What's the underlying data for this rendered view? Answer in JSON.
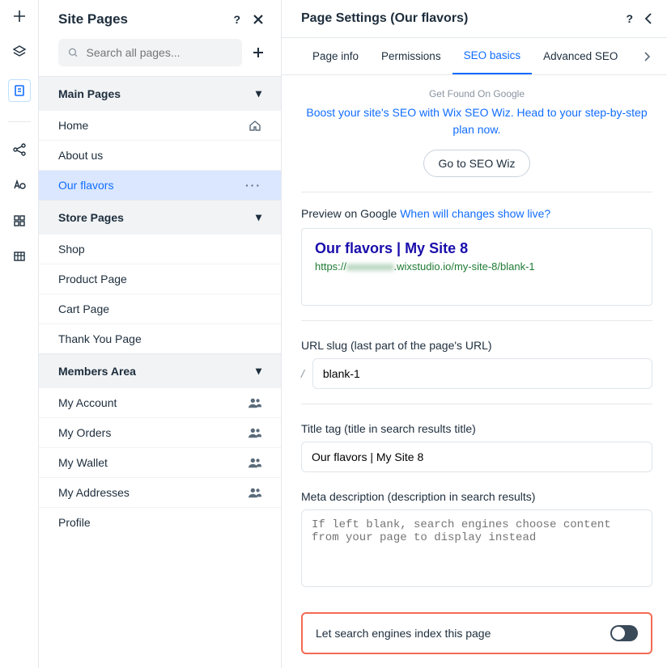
{
  "rail": {
    "icons": [
      "plus",
      "layers",
      "page",
      "share",
      "typography",
      "apps",
      "table"
    ]
  },
  "sidebar": {
    "title": "Site Pages",
    "search_placeholder": "Search all pages...",
    "sections": [
      {
        "label": "Main Pages",
        "items": [
          {
            "label": "Home",
            "icon": "home"
          },
          {
            "label": "About us"
          },
          {
            "label": "Our flavors",
            "selected": true,
            "more": true
          }
        ]
      },
      {
        "label": "Store Pages",
        "items": [
          {
            "label": "Shop"
          },
          {
            "label": "Product Page"
          },
          {
            "label": "Cart Page"
          },
          {
            "label": "Thank You Page"
          }
        ]
      },
      {
        "label": "Members Area",
        "items": [
          {
            "label": "My Account",
            "icon": "members"
          },
          {
            "label": "My Orders",
            "icon": "members"
          },
          {
            "label": "My Wallet",
            "icon": "members"
          },
          {
            "label": "My Addresses",
            "icon": "members"
          },
          {
            "label": "Profile"
          }
        ]
      }
    ]
  },
  "settings": {
    "title": "Page Settings (Our flavors)",
    "tabs": [
      "Page info",
      "Permissions",
      "SEO basics",
      "Advanced SEO"
    ],
    "active_tab": 2,
    "promo_top": "Get Found On Google",
    "promo_text": "Boost your site's SEO with Wix SEO Wiz. Head to your step-by-step plan now.",
    "promo_button": "Go to SEO Wiz",
    "preview_label": "Preview on Google ",
    "preview_link": "When will changes show live?",
    "seo_preview": {
      "title": "Our flavors | My Site 8",
      "url_prefix": "https://",
      "url_hidden": "xxxxxxxxx",
      "url_suffix": ".wixstudio.io/my-site-8/blank-1"
    },
    "slug": {
      "label": "URL slug (last part of the page's URL)",
      "value": "blank-1"
    },
    "title_tag": {
      "label": "Title tag (title in search results title)",
      "value": "Our flavors | My Site 8"
    },
    "meta": {
      "label": "Meta description (description in search results)",
      "placeholder": "If left blank, search engines choose content from your page to display instead"
    },
    "index_toggle": {
      "label": "Let search engines index this page",
      "value": false
    }
  }
}
